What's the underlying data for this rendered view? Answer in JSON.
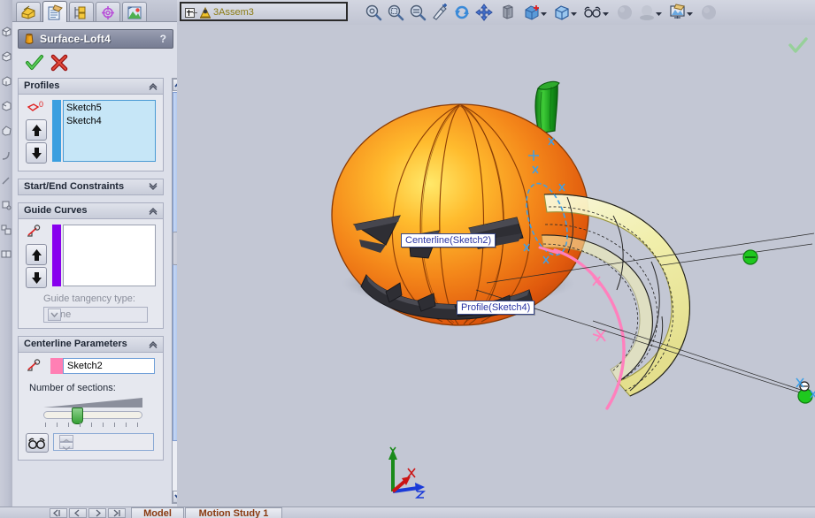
{
  "app": {
    "document_tab": "3Assem3",
    "viewport_bg": "#c3c7d4"
  },
  "property_manager": {
    "tabs": [
      {
        "name": "feature-manager-tab",
        "icon": "feature-tree-icon",
        "active": false
      },
      {
        "name": "property-manager-tab",
        "icon": "property-page-icon",
        "active": true
      },
      {
        "name": "configuration-manager-tab",
        "icon": "configuration-icon",
        "active": false
      },
      {
        "name": "dimxpert-manager-tab",
        "icon": "dimxpert-target-icon",
        "active": false
      },
      {
        "name": "display-manager-tab",
        "icon": "display-appearance-icon",
        "active": false
      }
    ],
    "title": "Surface-Loft4",
    "help_label": "?",
    "ok_label": "OK",
    "cancel_label": "Cancel",
    "groups": {
      "profiles": {
        "header": "Profiles",
        "items": [
          "Sketch5",
          "Sketch4"
        ],
        "move_up_label": "Move Up",
        "move_down_label": "Move Down",
        "selection_color": "#3a9fe0"
      },
      "start_end_constraints": {
        "header": "Start/End Constraints",
        "collapsed": true
      },
      "guide_curves": {
        "header": "Guide Curves",
        "items": [],
        "move_up_label": "Move Up",
        "move_down_label": "Move Down",
        "selection_color": "#8800ee",
        "tangency_label": "Guide tangency type:",
        "tangency_value": "None"
      },
      "centerline_parameters": {
        "header": "Centerline Parameters",
        "centerline_value": "Sketch2",
        "centerline_color": "#ff7fb4",
        "sections_label": "Number of sections:",
        "sections_value": "1",
        "slider_percent": 32,
        "show_sections_label": "Show Sections"
      }
    }
  },
  "toolbar": {
    "icons": [
      {
        "name": "zoom-to-fit-icon",
        "label": "Zoom to Fit"
      },
      {
        "name": "zoom-to-area-icon",
        "label": "Zoom to Area"
      },
      {
        "name": "zoom-in-out-icon",
        "label": "Zoom In/Out"
      },
      {
        "name": "previous-view-icon",
        "label": "Previous View"
      },
      {
        "name": "rotate-view-icon",
        "label": "Rotate View"
      },
      {
        "name": "pan-icon",
        "label": "Pan"
      },
      {
        "name": "section-view-icon",
        "label": "Section View"
      },
      {
        "name": "view-orientation-icon",
        "label": "View Orientation"
      },
      {
        "name": "display-style-icon",
        "label": "Display Style"
      },
      {
        "name": "hide-show-items-icon",
        "label": "Hide/Show Items"
      },
      {
        "name": "edit-appearance-icon",
        "label": "Edit Appearance"
      },
      {
        "name": "apply-scene-icon",
        "label": "Apply Scene"
      },
      {
        "name": "view-settings-icon",
        "label": "View Settings"
      },
      {
        "name": "render-sphere-icon",
        "label": "Render Tools"
      }
    ]
  },
  "viewport": {
    "callouts": [
      {
        "name": "centerline-callout",
        "text": "Centerline(Sketch2)"
      },
      {
        "name": "profile-callout",
        "text": "Profile(Sketch4)"
      }
    ],
    "triad": {
      "x": "X",
      "y": "Y",
      "z": "Z"
    },
    "model": {
      "name": "jack-o-lantern",
      "body_color": "#f08a1c",
      "stem_color": "#1f9a1f",
      "loft_preview_color": "#f2efa8"
    }
  },
  "bottom": {
    "tabs": [
      "Model",
      "Motion Study 1"
    ],
    "nav_labels": [
      "first",
      "previous",
      "next",
      "last"
    ]
  }
}
